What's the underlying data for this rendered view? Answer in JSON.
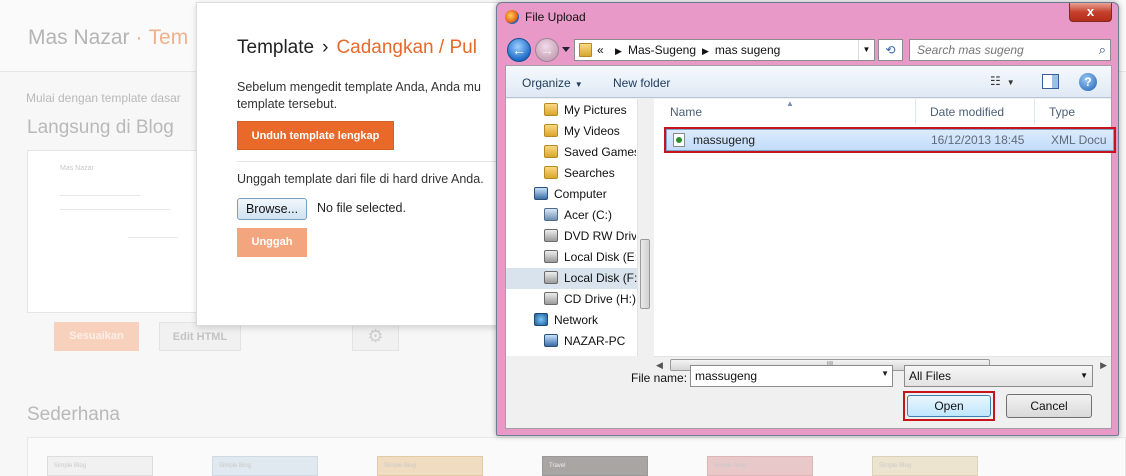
{
  "background_page": {
    "blog_name": "Mas Nazar",
    "separator": "·",
    "breadcrumb_partial": "Tem",
    "subtitle": "Mulai dengan template dasar",
    "live_heading": "Langsung di Blog",
    "thumb_title": "Mas Nazar",
    "customize_label": "Sesuaikan",
    "edit_html_label": "Edit HTML",
    "simple_heading": "Sederhana",
    "mini_templates": [
      "Simple Blog",
      "Simple Blog",
      "Simple Blog",
      "Travel",
      "Simple Blog",
      "Simple Blog"
    ]
  },
  "template_dialog": {
    "title": "Template",
    "separator": "›",
    "subtitle": "Cadangkan / Pul",
    "backup_text_line1": "Sebelum mengedit template Anda, Anda mu",
    "backup_text_line2": "template tersebut.",
    "download_button": "Unduh template lengkap",
    "upload_text": "Unggah template dari file di hard drive Anda.",
    "browse_button": "Browse...",
    "no_file_text": "No file selected.",
    "upload_button": "Unggah"
  },
  "file_dialog": {
    "title": "File Upload",
    "close_glyph": "x",
    "address": {
      "prefix": "«",
      "crumbs": [
        "Mas-Sugeng",
        "mas sugeng"
      ]
    },
    "search_placeholder": "Search mas sugeng",
    "toolbar": {
      "organize": "Organize",
      "new_folder": "New folder"
    },
    "nav_items": [
      {
        "label": "My Pictures",
        "icon": "folder-icon"
      },
      {
        "label": "My Videos",
        "icon": "folder-icon"
      },
      {
        "label": "Saved Games",
        "icon": "folder-icon"
      },
      {
        "label": "Searches",
        "icon": "folder-icon"
      },
      {
        "label": "Computer",
        "icon": "computer-icon"
      },
      {
        "label": "Acer (C:)",
        "icon": "drive-icon"
      },
      {
        "label": "DVD RW Drive",
        "icon": "dvd-drive-icon"
      },
      {
        "label": "Local Disk (E:",
        "icon": "drive-icon"
      },
      {
        "label": "Local Disk (F:",
        "icon": "drive-icon"
      },
      {
        "label": "CD Drive (H:)",
        "icon": "cd-drive-icon"
      },
      {
        "label": "Network",
        "icon": "network-icon"
      },
      {
        "label": "NAZAR-PC",
        "icon": "pc-icon"
      }
    ],
    "selected_nav_index": 8,
    "columns": {
      "name": "Name",
      "date": "Date modified",
      "type": "Type"
    },
    "files": [
      {
        "name": "massugeng",
        "date": "16/12/2013 18:45",
        "type": "XML Docu"
      }
    ],
    "file_name_label": "File name:",
    "file_name_value": "massugeng",
    "file_type": "All Files",
    "open_button": "Open",
    "cancel_button": "Cancel"
  },
  "colors": {
    "blogger_orange": "#e8692a",
    "dialog_frame": "#e899c7",
    "highlight_red": "#c4151c"
  }
}
